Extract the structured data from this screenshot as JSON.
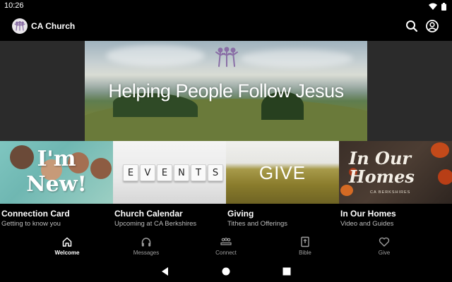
{
  "status": {
    "time": "10:26"
  },
  "app": {
    "title": "CA Church"
  },
  "hero": {
    "headline": "Helping People Follow Jesus"
  },
  "cards": [
    {
      "title": "Connection Card",
      "subtitle": "Getting to know you",
      "image_text": "I'm New!"
    },
    {
      "title": "Church Calendar",
      "subtitle": "Upcoming at CA Berkshires",
      "image_text": "EVENTS"
    },
    {
      "title": "Giving",
      "subtitle": "Tithes and Offerings",
      "image_text": "GIVE"
    },
    {
      "title": "In Our Homes",
      "subtitle": "Video and Guides",
      "image_text": "In Our Homes",
      "image_subtext": "CA BERKSHIRES"
    }
  ],
  "nav": [
    {
      "label": "Welcome",
      "icon": "home-icon",
      "active": true
    },
    {
      "label": "Messages",
      "icon": "headphones-icon",
      "active": false
    },
    {
      "label": "Connect",
      "icon": "people-icon",
      "active": false
    },
    {
      "label": "Bible",
      "icon": "bible-icon",
      "active": false
    },
    {
      "label": "Give",
      "icon": "heart-icon",
      "active": false
    }
  ],
  "colors": {
    "background": "#000000",
    "panel": "#2b2b2b",
    "muted_text": "#9e9e9e"
  }
}
